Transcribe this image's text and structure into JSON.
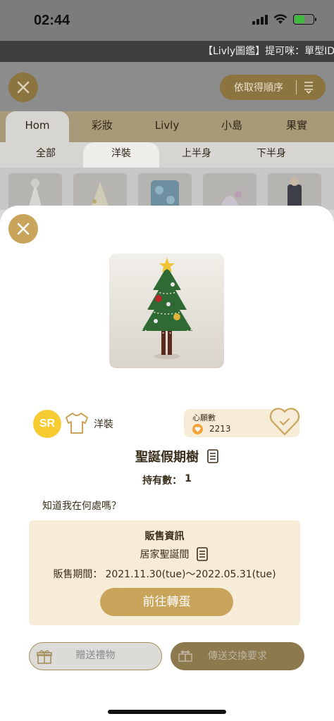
{
  "status_bar": {
    "time": "02:44"
  },
  "ticker": {
    "text": "【Livly圖鑑】提可咪：單型ID"
  },
  "header": {
    "sort_label": "依取得順序"
  },
  "category_tabs": [
    {
      "label": "Hom",
      "active": true
    },
    {
      "label": "彩妝",
      "active": false
    },
    {
      "label": "Livly",
      "active": false
    },
    {
      "label": "小島",
      "active": false
    },
    {
      "label": "果實",
      "active": false
    }
  ],
  "sub_tabs": [
    {
      "label": "全部",
      "active": false
    },
    {
      "label": "洋裝",
      "active": true
    },
    {
      "label": "上半身",
      "active": false
    },
    {
      "label": "下半身",
      "active": false
    }
  ],
  "item": {
    "rarity": "SR",
    "category": "洋裝",
    "wish_label": "心願數",
    "wish_count": "2213",
    "name": "聖誕假期樹",
    "own_label": "持有數：",
    "own_value": "1",
    "question": "知道我在何處嗎？"
  },
  "sale": {
    "title": "販售資訊",
    "shop": "居家聖誕間",
    "period_label": "販售期間：",
    "period_value": "2021.11.30(tue)〜2022.05.31(tue)",
    "goto_button": "前往轉蛋"
  },
  "actions": {
    "gift_button": "贈送禮物",
    "trade_button": "傳送交換要求"
  },
  "colors": {
    "accent_gold": "#c9a55b",
    "panel_cream": "#f7ecd8",
    "rarity_yellow": "#f6cc32",
    "battery_green": "#3fb83f"
  },
  "icons": [
    "close-icon",
    "sort-icon",
    "shirt-icon",
    "heart-icon",
    "document-icon",
    "gift-icon",
    "trade-icon",
    "wifi-icon",
    "battery-icon"
  ]
}
